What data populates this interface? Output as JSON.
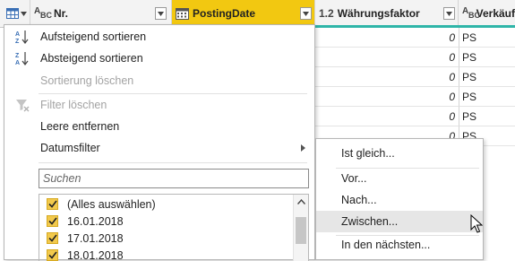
{
  "header": {
    "columns": [
      {
        "label": "Nr.",
        "type_icon": "text-type-icon"
      },
      {
        "label": "PostingDate",
        "type_icon": "calendar-type-icon",
        "selected": true
      },
      {
        "label": "Währungsfaktor",
        "type_prefix": "1.2",
        "type_icon": "decimal-type-icon"
      },
      {
        "label": "Verkäuf",
        "type_icon": "text-type-icon"
      }
    ],
    "accent_color": "#2fb5a8",
    "selected_color": "#f2c811"
  },
  "rows": [
    {
      "factor": "0",
      "seller": "PS"
    },
    {
      "factor": "0",
      "seller": "PS"
    },
    {
      "factor": "0",
      "seller": "PS"
    },
    {
      "factor": "0",
      "seller": "PS"
    },
    {
      "factor": "0",
      "seller": "PS"
    },
    {
      "factor": "0",
      "seller": "PS"
    }
  ],
  "menu": {
    "items": [
      {
        "label": "Aufsteigend sortieren",
        "icon": "sort-ascending-icon",
        "enabled": true
      },
      {
        "label": "Absteigend sortieren",
        "icon": "sort-descending-icon",
        "enabled": true
      },
      {
        "label": "Sortierung löschen",
        "enabled": false
      },
      {
        "label": "Filter löschen",
        "icon": "clear-filter-icon",
        "enabled": false
      },
      {
        "label": "Leere entfernen",
        "enabled": true
      },
      {
        "label": "Datumsfilter",
        "enabled": true,
        "has_submenu": true
      }
    ],
    "search_placeholder": "Suchen",
    "values": [
      {
        "label": "(Alles auswählen)",
        "checked": true
      },
      {
        "label": "16.01.2018",
        "checked": true
      },
      {
        "label": "17.01.2018",
        "checked": true
      },
      {
        "label": "18.01.2018",
        "checked": true
      }
    ]
  },
  "submenu": {
    "items": [
      {
        "label": "Ist gleich..."
      },
      {
        "label": "Vor..."
      },
      {
        "label": "Nach..."
      },
      {
        "label": "Zwischen...",
        "hovered": true
      },
      {
        "label": "In den nächsten..."
      }
    ]
  }
}
